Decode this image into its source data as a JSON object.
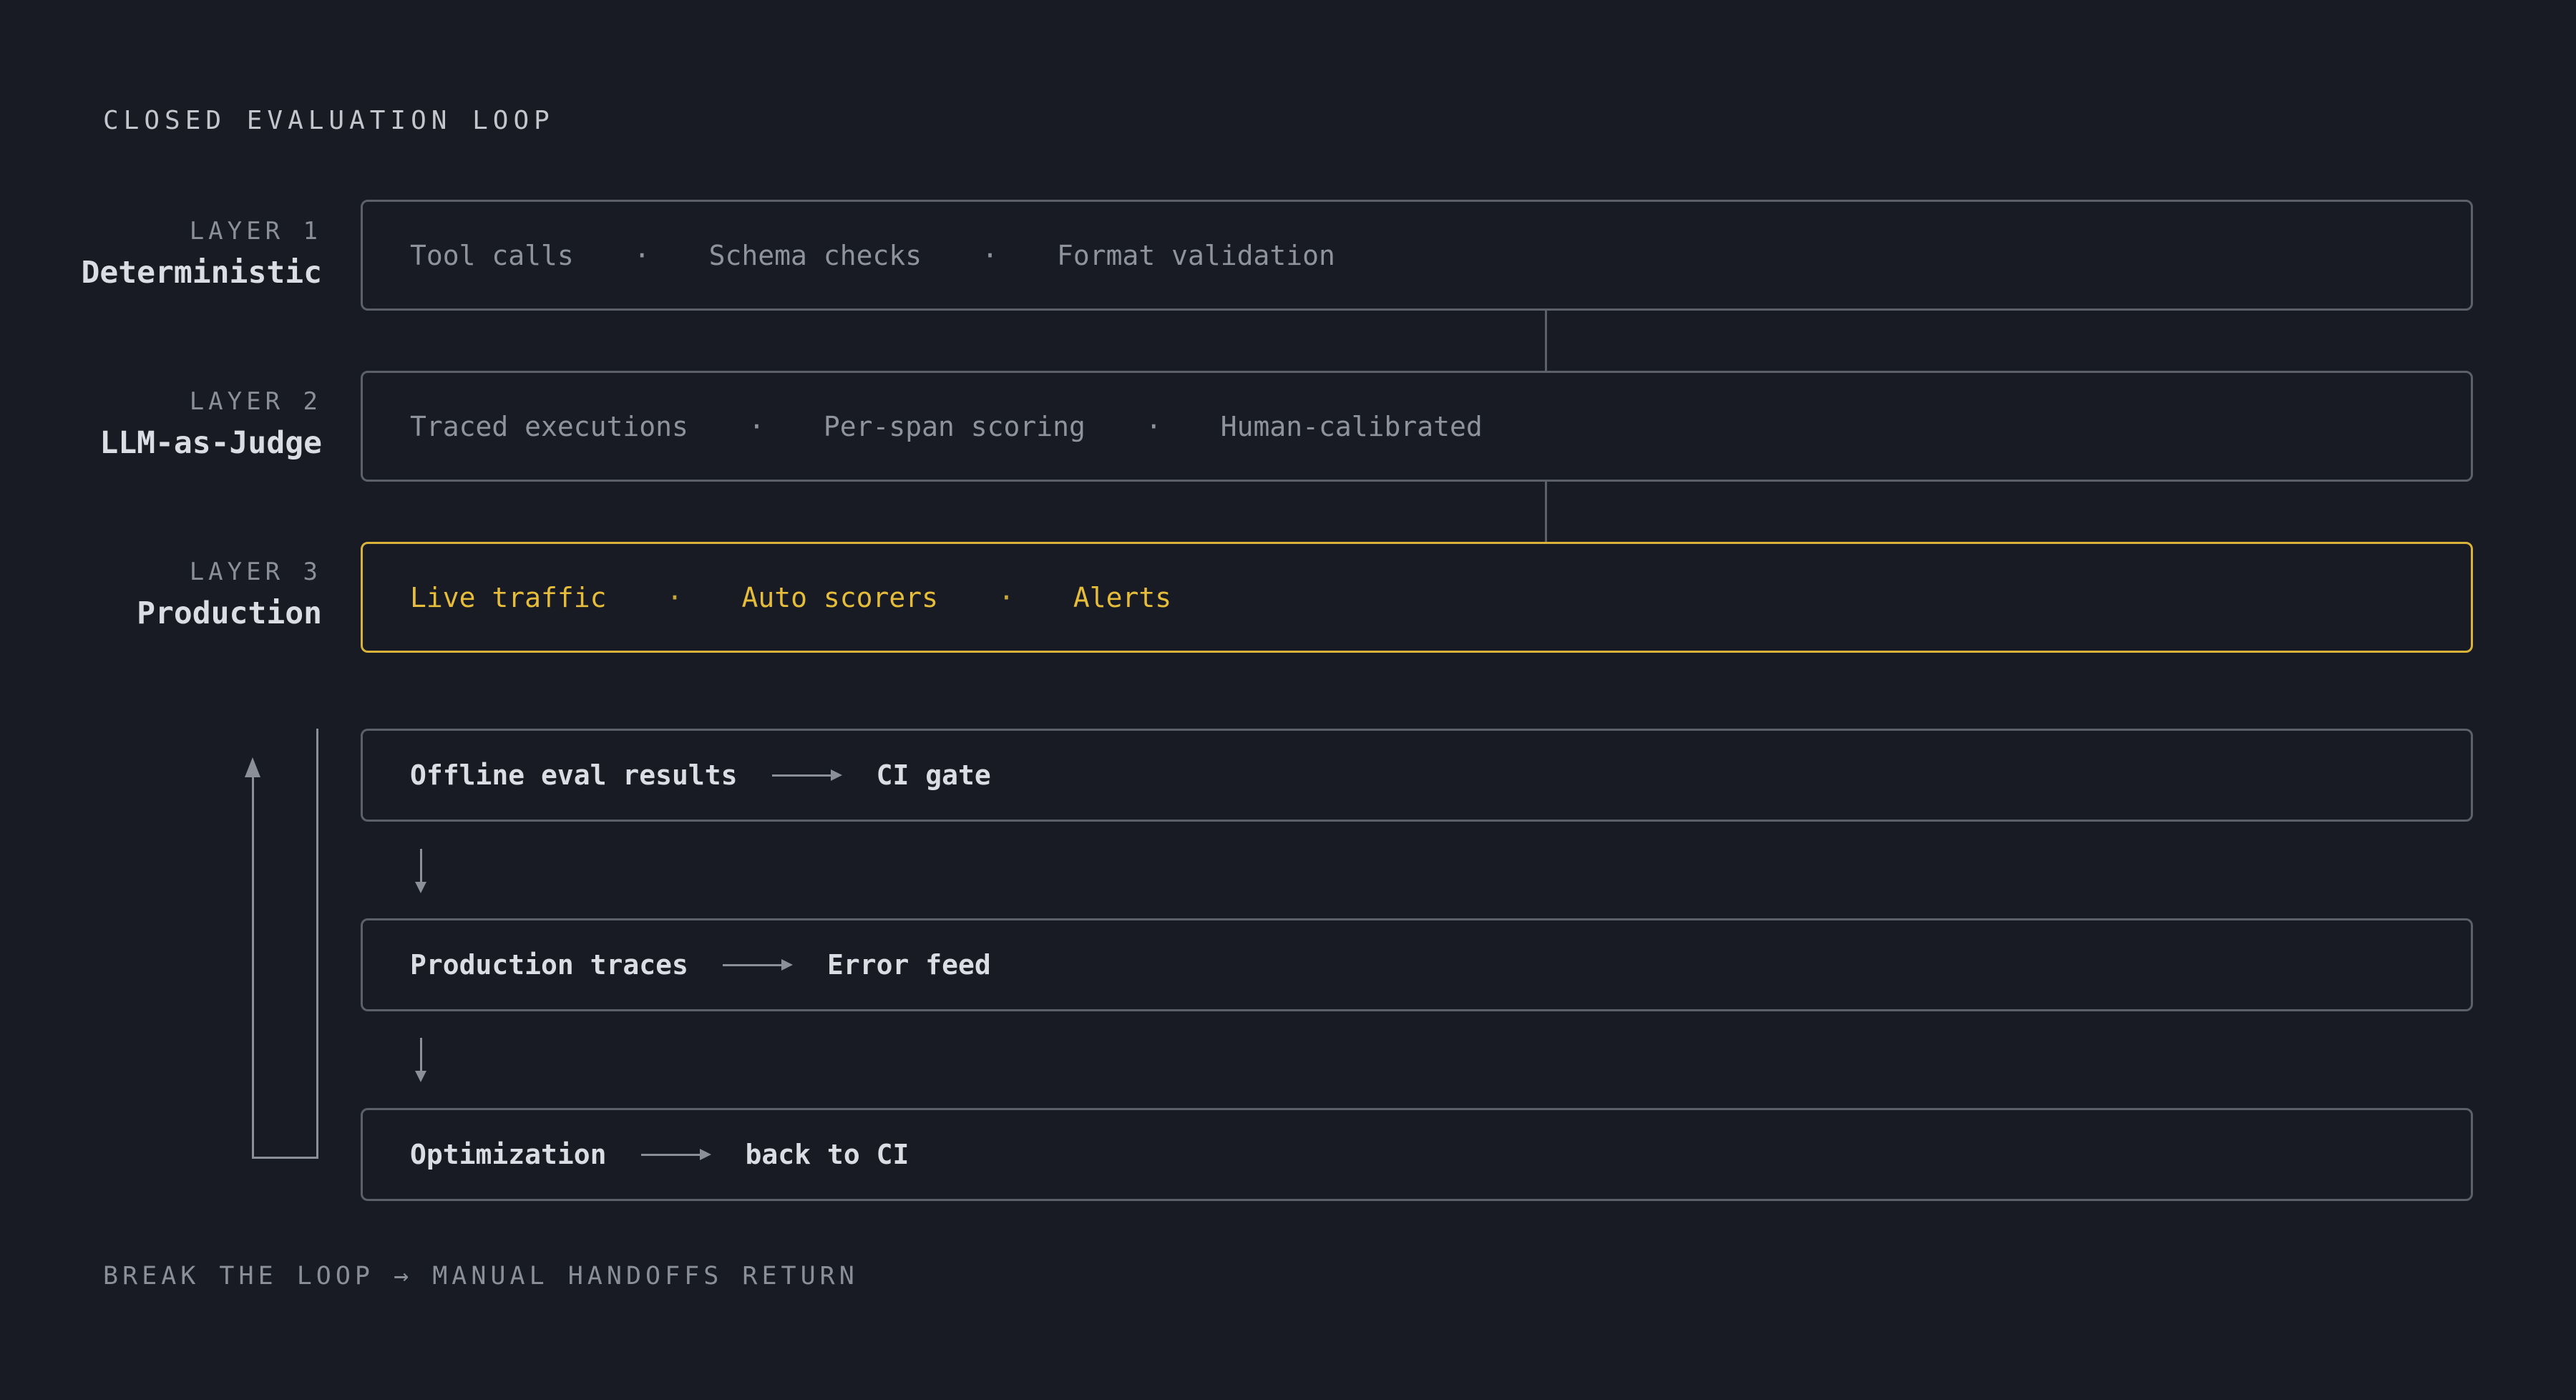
{
  "title": "CLOSED EVALUATION LOOP",
  "layers": [
    {
      "number": "LAYER 1",
      "name": "Deterministic",
      "items": [
        "Tool calls",
        "Schema checks",
        "Format validation"
      ]
    },
    {
      "number": "LAYER 2",
      "name": "LLM-as-Judge",
      "items": [
        "Traced executions",
        "Per-span scoring",
        "Human-calibrated"
      ]
    },
    {
      "number": "LAYER 3",
      "name": "Production",
      "items": [
        "Live traffic",
        "Auto scorers",
        "Alerts"
      ]
    }
  ],
  "separator": "·",
  "flow": [
    {
      "from": "Offline eval results",
      "to": "CI gate"
    },
    {
      "from": "Production traces",
      "to": "Error feed"
    },
    {
      "from": "Optimization",
      "to": "back to CI"
    }
  ],
  "footer": "BREAK THE LOOP → MANUAL HANDOFFS RETURN",
  "colors": {
    "background": "#181b23",
    "border": "#5c6069",
    "accent": "#e6bd3a",
    "text": "#dadde3",
    "muted": "#8f939c"
  }
}
